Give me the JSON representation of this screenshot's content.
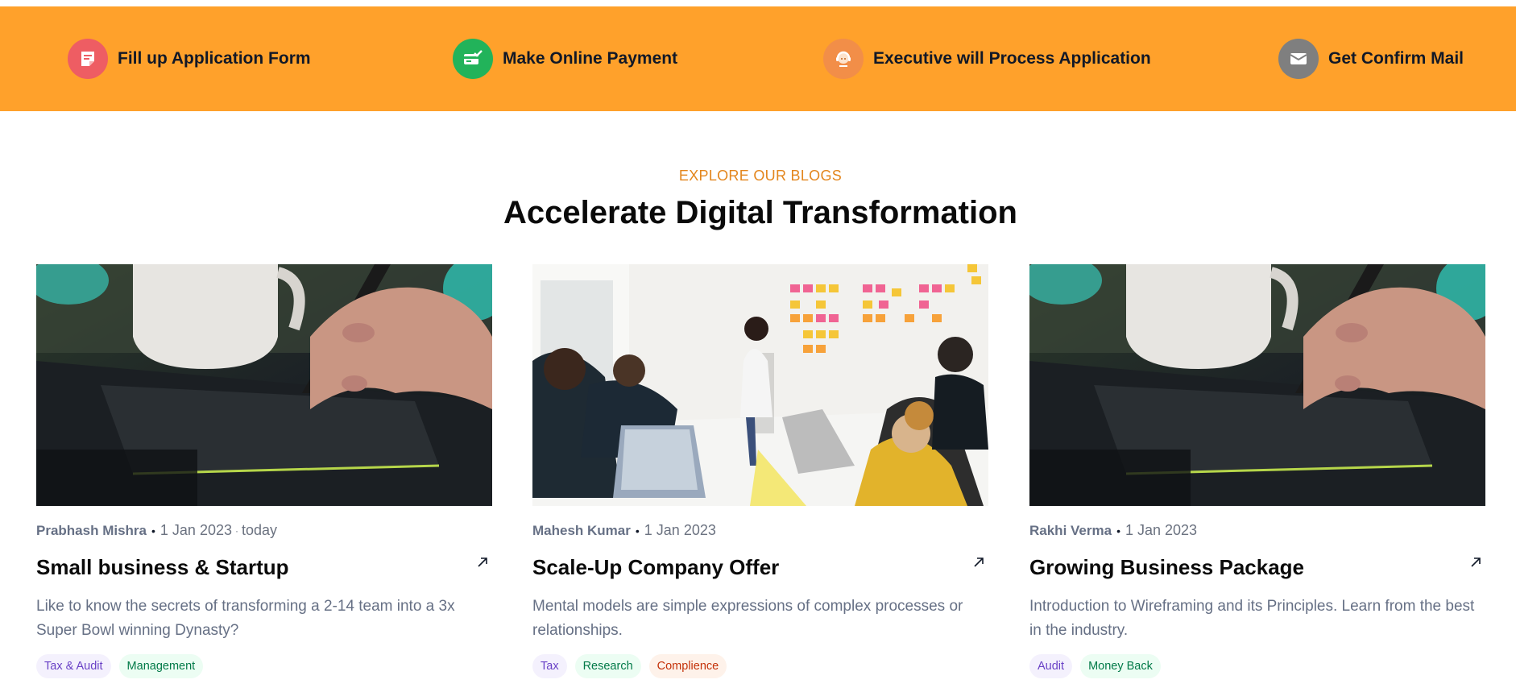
{
  "steps": [
    {
      "label": "Fill up Application Form",
      "icon": "form-icon",
      "color": "#ee5d63"
    },
    {
      "label": "Make Online Payment",
      "icon": "payment-icon",
      "color": "#22b35a"
    },
    {
      "label": "Executive will Process Application",
      "icon": "executive-icon",
      "color": "#f28e48"
    },
    {
      "label": "Get Confirm Mail",
      "icon": "mail-icon",
      "color": "#7f7f7f"
    }
  ],
  "section": {
    "eyebrow": "EXPLORE OUR BLOGS",
    "title": "Accelerate Digital Transformation"
  },
  "cards": [
    {
      "author": "Prabhash Mishra",
      "date": "1 Jan 2023",
      "extra": "today",
      "title": "Small business & Startup",
      "description": "Like to know the secrets of transforming a 2-14 team into a 3x Super Bowl winning Dynasty?",
      "image": "hand-drawing-tablet-photo",
      "tags": [
        {
          "label": "Tax & Audit",
          "color": "purple"
        },
        {
          "label": "Management",
          "color": "green"
        }
      ]
    },
    {
      "author": "Mahesh Kumar",
      "date": "1 Jan 2023",
      "title": "Scale-Up Company Offer",
      "description": "Mental models are simple expressions of complex processes or relationships.",
      "image": "team-meeting-sticky-notes-photo",
      "tags": [
        {
          "label": "Tax",
          "color": "purple"
        },
        {
          "label": "Research",
          "color": "green"
        },
        {
          "label": "Complience",
          "color": "orange"
        }
      ]
    },
    {
      "author": "Rakhi Verma",
      "date": "1 Jan 2023",
      "title": "Growing Business Package",
      "description": "Introduction to Wireframing and its Principles. Learn from the best in the industry.",
      "image": "hand-drawing-tablet-photo",
      "tags": [
        {
          "label": "Audit",
          "color": "purple"
        },
        {
          "label": "Money Back",
          "color": "green"
        }
      ]
    }
  ],
  "colors": {
    "accent_bar": "#ffa12b",
    "eyebrow": "#e3861d"
  }
}
